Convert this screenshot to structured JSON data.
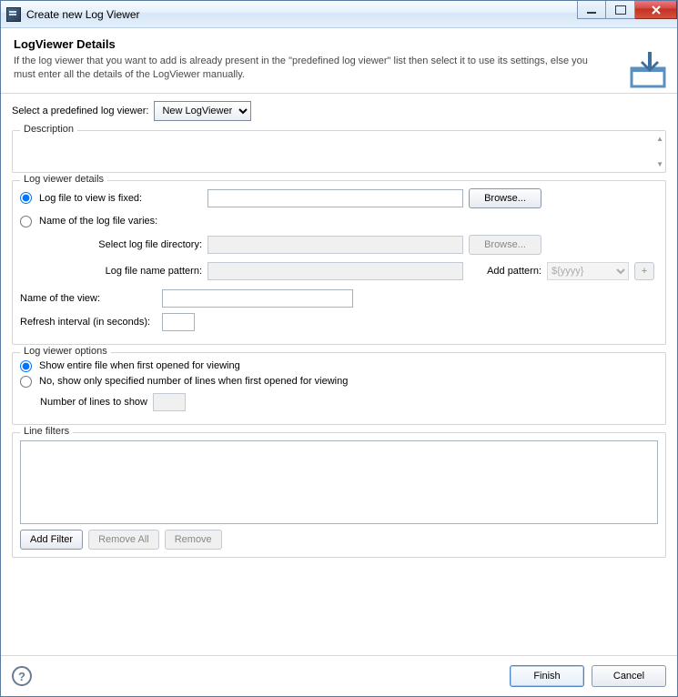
{
  "titlebar": {
    "title": "Create new Log Viewer"
  },
  "banner": {
    "heading": "LogViewer Details",
    "subtext": "If the log viewer that you want to add is already present in the \"predefined log viewer\" list then select it to use its settings, else you must enter all the details of the LogViewer manually."
  },
  "predef": {
    "label": "Select a predefined log viewer:",
    "selected": "New LogViewer",
    "options": [
      "New LogViewer"
    ]
  },
  "description": {
    "legend": "Description",
    "value": ""
  },
  "details": {
    "legend": "Log viewer details",
    "fixed_radio": "Log file to view is fixed:",
    "fixed_value": "",
    "browse": "Browse...",
    "varies_radio": "Name of the log file varies:",
    "dir_label": "Select log file directory:",
    "dir_value": "",
    "dir_browse": "Browse...",
    "pattern_label": "Log file name pattern:",
    "pattern_value": "",
    "add_pattern_label": "Add pattern:",
    "add_pattern_selected": "${yyyy}",
    "add_pattern_plus": "+",
    "view_name_label": "Name of the view:",
    "view_name_value": "",
    "refresh_label": "Refresh interval (in seconds):",
    "refresh_value": ""
  },
  "options": {
    "legend": "Log viewer options",
    "show_all": "Show entire file when first opened for viewing",
    "show_n": "No, show only specified number of lines when first opened for viewing",
    "n_label": "Number of lines to show",
    "n_value": ""
  },
  "filters": {
    "legend": "Line filters",
    "add": "Add Filter",
    "remove_all": "Remove All",
    "remove": "Remove"
  },
  "buttons": {
    "finish": "Finish",
    "cancel": "Cancel"
  }
}
